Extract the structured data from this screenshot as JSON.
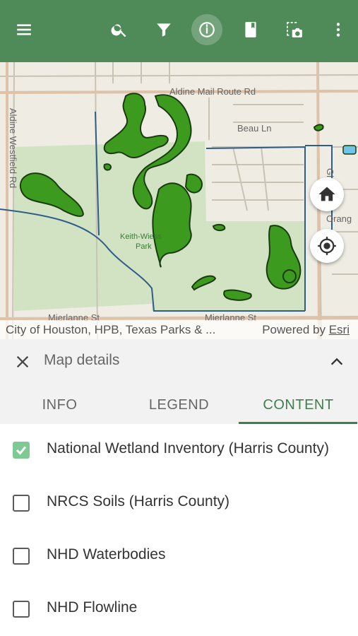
{
  "toolbar": {
    "icons": [
      "menu-icon",
      "search-icon",
      "filter-icon",
      "info-icon",
      "bookmark-icon",
      "screenshot-icon",
      "more-vert-icon"
    ],
    "active_icon": "info-icon",
    "color": "#4f8b58"
  },
  "map": {
    "labels": {
      "road_top": "Aldine Mail Route Rd",
      "road_left": "Aldine Westfield Rd",
      "street_beau": "Beau Ln",
      "road_right": "Glo",
      "orange": "Orang",
      "park": "Keith-Wiess",
      "park2": "Park",
      "merlanne_left": "Mierlanne St",
      "merlanne_right": "Mierlanne St"
    },
    "wetland_color": "#3c9a1f",
    "park_color": "#d2e3c4",
    "buttons": [
      "home-icon",
      "locate-icon"
    ]
  },
  "attribution": {
    "left": "City of Houston, HPB, Texas Parks & ...",
    "right_prefix": "Powered by ",
    "right_link": "Esri"
  },
  "panel": {
    "title": "Map details",
    "tabs": [
      "INFO",
      "LEGEND",
      "CONTENT"
    ],
    "active_tab": "CONTENT",
    "accent": "#3f7f4c",
    "layers": [
      {
        "label": "National Wetland Inventory (Harris County)",
        "checked": true
      },
      {
        "label": "NRCS Soils (Harris County)",
        "checked": false
      },
      {
        "label": "NHD Waterbodies",
        "checked": false
      },
      {
        "label": "NHD Flowline",
        "checked": false
      }
    ]
  }
}
